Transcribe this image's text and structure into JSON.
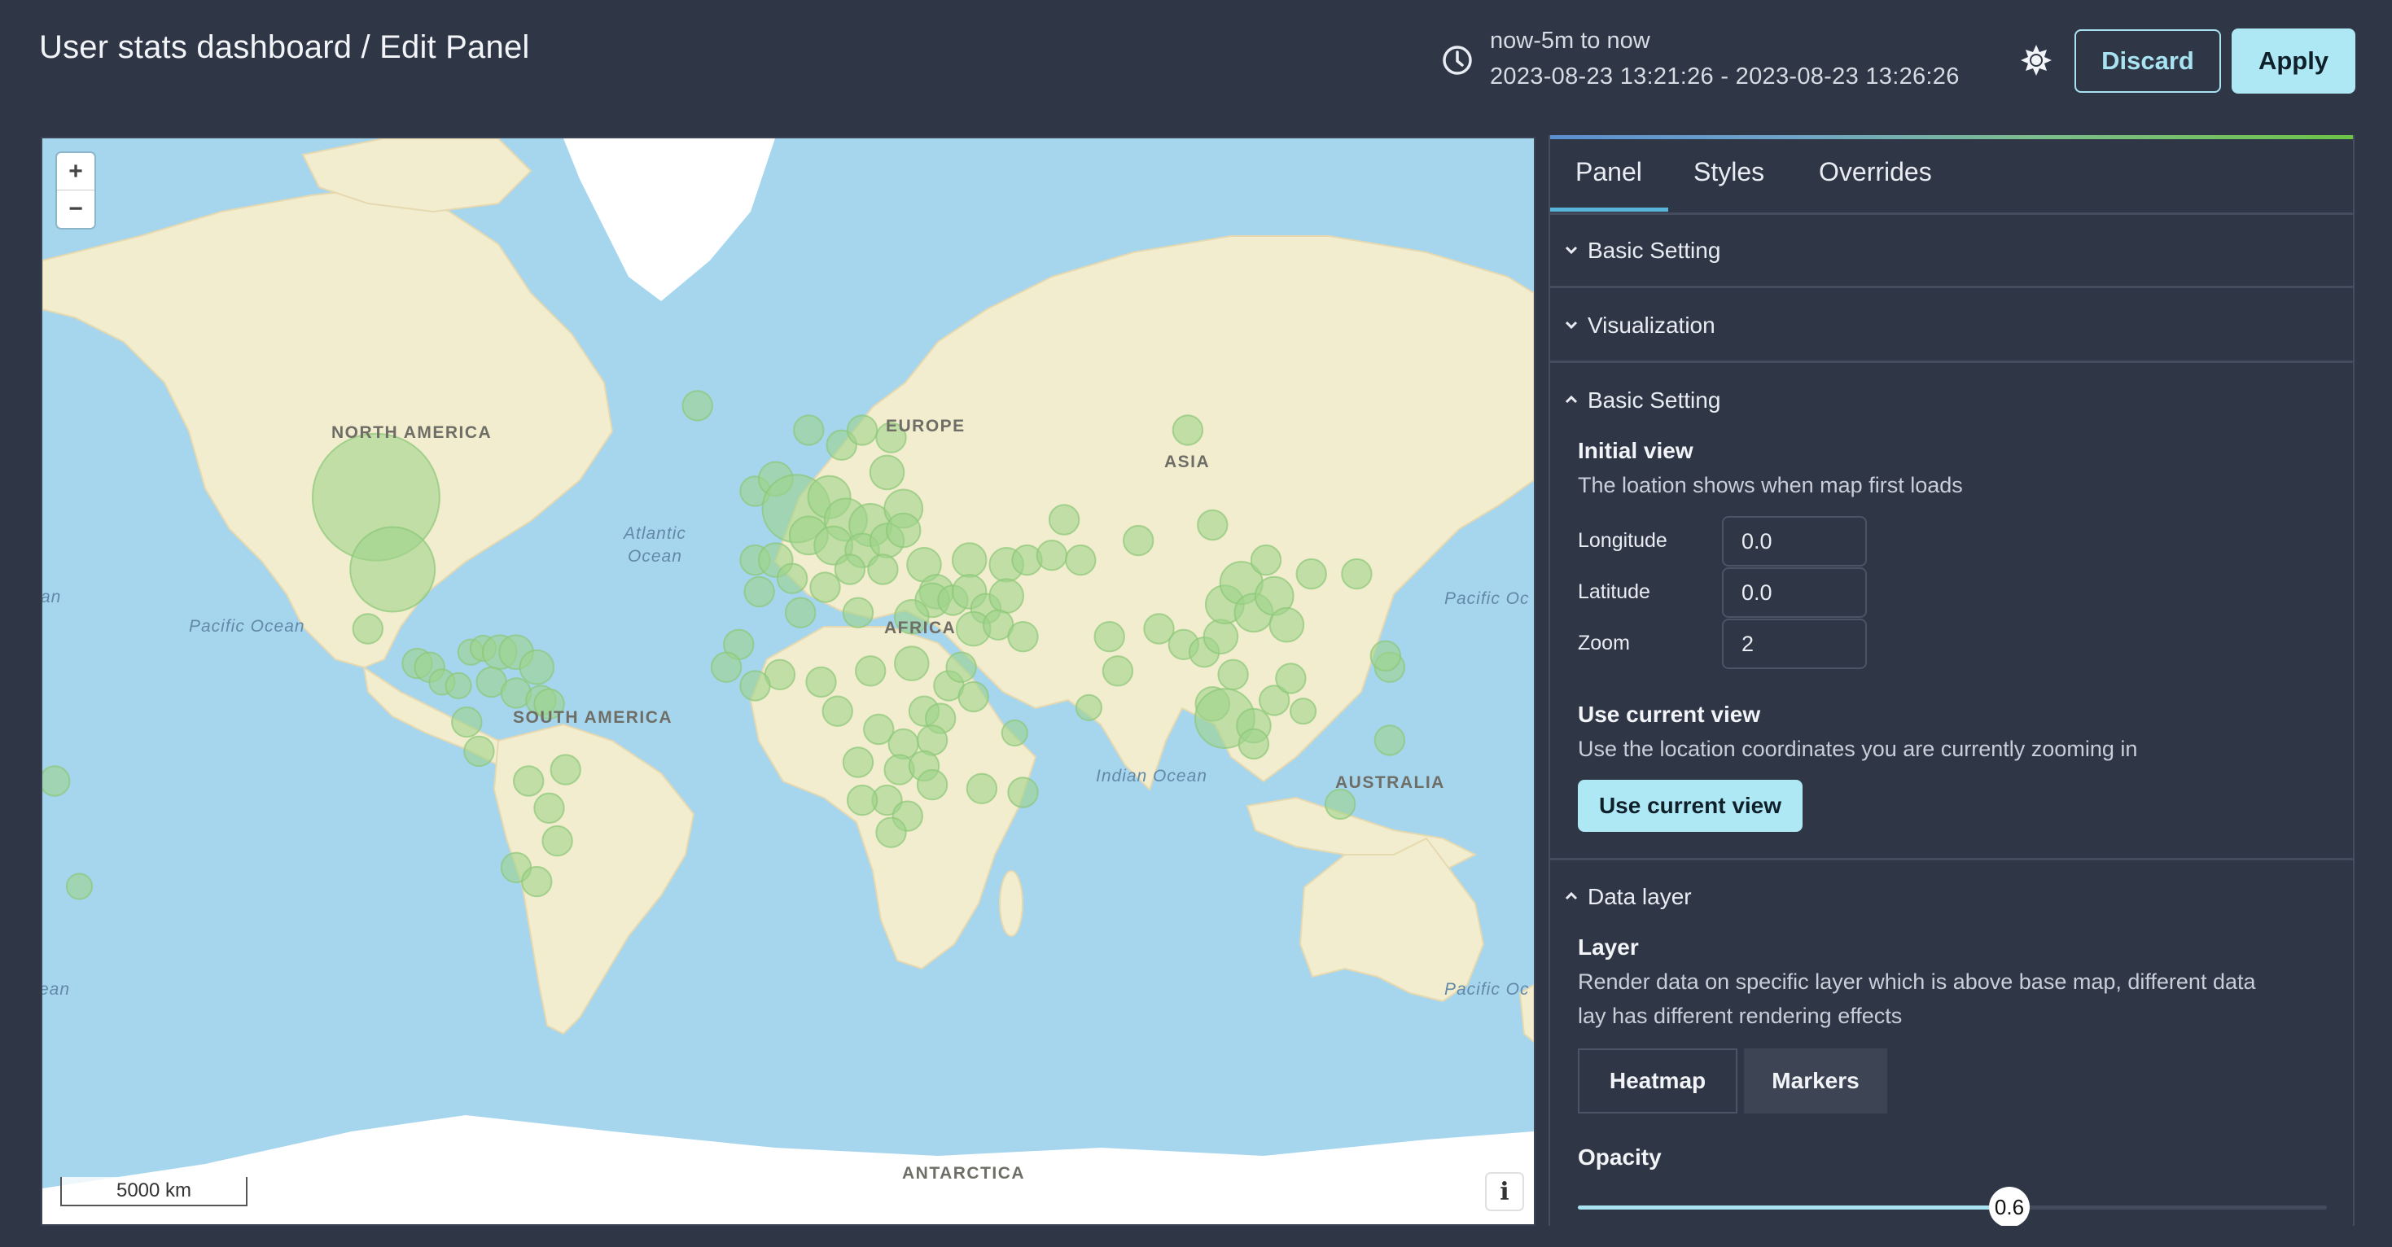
{
  "header": {
    "title": "User stats dashboard / Edit Panel",
    "time_range_label": "now-5m to now",
    "time_range_absolute": "2023-08-23 13:21:26 - 2023-08-23 13:26:26",
    "clock_icon": "clock-icon",
    "theme_icon": "sun-icon",
    "discard_label": "Discard",
    "apply_label": "Apply"
  },
  "map": {
    "zoom_in_label": "+",
    "zoom_out_label": "−",
    "scale_label": "5000 km",
    "info_label": "i",
    "continent_labels": [
      "NORTH AMERICA",
      "SOUTH AMERICA",
      "EUROPE",
      "AFRICA",
      "ASIA",
      "AUSTRALIA",
      "ANTARCTICA"
    ],
    "ocean_labels": {
      "atlantic_line1": "Atlantic",
      "atlantic_line2": "Ocean",
      "pacific_west": "Pacific Ocean",
      "pacific_east_north": "Pacific Oc",
      "pacific_east_south": "Pacific Oc",
      "indian": "Indian Ocean",
      "left_edge_north": "an",
      "left_edge_south": "ean"
    },
    "marker_color": "#9fd48a",
    "marker_opacity": 0.6,
    "markers": [
      {
        "lon": -100,
        "lat": 52,
        "size": 3.0
      },
      {
        "lon": -96,
        "lat": 38,
        "size": 2.0
      },
      {
        "lon": -102,
        "lat": 24,
        "size": 0.7
      },
      {
        "lon": -90,
        "lat": 15,
        "size": 0.7
      },
      {
        "lon": -87,
        "lat": 14,
        "size": 0.7
      },
      {
        "lon": -84,
        "lat": 10,
        "size": 0.6
      },
      {
        "lon": -80,
        "lat": 9,
        "size": 0.6
      },
      {
        "lon": -77,
        "lat": 18,
        "size": 0.6
      },
      {
        "lon": -74,
        "lat": 19,
        "size": 0.6
      },
      {
        "lon": -70,
        "lat": 18,
        "size": 0.8
      },
      {
        "lon": -66,
        "lat": 18,
        "size": 0.8
      },
      {
        "lon": -61,
        "lat": 14,
        "size": 0.8
      },
      {
        "lon": -72,
        "lat": 10,
        "size": 0.7
      },
      {
        "lon": -66,
        "lat": 7,
        "size": 0.7
      },
      {
        "lon": -60,
        "lat": 5,
        "size": 0.7
      },
      {
        "lon": -58,
        "lat": 4,
        "size": 0.7
      },
      {
        "lon": -78,
        "lat": -1,
        "size": 0.7
      },
      {
        "lon": -75,
        "lat": -9,
        "size": 0.7
      },
      {
        "lon": -63,
        "lat": -17,
        "size": 0.7
      },
      {
        "lon": -54,
        "lat": -14,
        "size": 0.7
      },
      {
        "lon": -58,
        "lat": -24,
        "size": 0.7
      },
      {
        "lon": -56,
        "lat": -32,
        "size": 0.7
      },
      {
        "lon": -66,
        "lat": -38,
        "size": 0.7
      },
      {
        "lon": -61,
        "lat": -41,
        "size": 0.7
      },
      {
        "lon": -178,
        "lat": -17,
        "size": 0.7
      },
      {
        "lon": -172,
        "lat": -42,
        "size": 0.6
      },
      {
        "lon": -22,
        "lat": 65,
        "size": 0.7
      },
      {
        "lon": -8,
        "lat": 53,
        "size": 0.7
      },
      {
        "lon": -3,
        "lat": 55,
        "size": 0.8
      },
      {
        "lon": 2,
        "lat": 50,
        "size": 1.6
      },
      {
        "lon": 5,
        "lat": 62,
        "size": 0.7
      },
      {
        "lon": 13,
        "lat": 60,
        "size": 0.7
      },
      {
        "lon": 18,
        "lat": 62,
        "size": 0.7
      },
      {
        "lon": 25,
        "lat": 61,
        "size": 0.7
      },
      {
        "lon": 24,
        "lat": 56,
        "size": 0.8
      },
      {
        "lon": 10,
        "lat": 52,
        "size": 1.0
      },
      {
        "lon": 14,
        "lat": 48,
        "size": 1.0
      },
      {
        "lon": 20,
        "lat": 47,
        "size": 1.0
      },
      {
        "lon": 28,
        "lat": 50,
        "size": 0.9
      },
      {
        "lon": 5,
        "lat": 45,
        "size": 0.9
      },
      {
        "lon": 11,
        "lat": 43,
        "size": 0.9
      },
      {
        "lon": 18,
        "lat": 42,
        "size": 0.8
      },
      {
        "lon": 24,
        "lat": 44,
        "size": 0.8
      },
      {
        "lon": 28,
        "lat": 46,
        "size": 0.8
      },
      {
        "lon": -8,
        "lat": 40,
        "size": 0.7
      },
      {
        "lon": -3,
        "lat": 40,
        "size": 0.8
      },
      {
        "lon": 1,
        "lat": 36,
        "size": 0.7
      },
      {
        "lon": -7,
        "lat": 33,
        "size": 0.7
      },
      {
        "lon": 9,
        "lat": 34,
        "size": 0.7
      },
      {
        "lon": 15,
        "lat": 38,
        "size": 0.7
      },
      {
        "lon": 23,
        "lat": 38,
        "size": 0.7
      },
      {
        "lon": 33,
        "lat": 39,
        "size": 0.8
      },
      {
        "lon": 44,
        "lat": 40,
        "size": 0.8
      },
      {
        "lon": 53,
        "lat": 39,
        "size": 0.8
      },
      {
        "lon": 67,
        "lat": 48,
        "size": 0.7
      },
      {
        "lon": 85,
        "lat": 44,
        "size": 0.7
      },
      {
        "lon": 103,
        "lat": 47,
        "size": 0.7
      },
      {
        "lon": 97,
        "lat": 62,
        "size": 0.7
      },
      {
        "lon": 58,
        "lat": 40,
        "size": 0.7
      },
      {
        "lon": 64,
        "lat": 41,
        "size": 0.7
      },
      {
        "lon": 71,
        "lat": 40,
        "size": 0.7
      },
      {
        "lon": 36,
        "lat": 33,
        "size": 0.8
      },
      {
        "lon": 35,
        "lat": 31,
        "size": 0.8
      },
      {
        "lon": 40,
        "lat": 31,
        "size": 0.7
      },
      {
        "lon": 44,
        "lat": 33,
        "size": 0.8
      },
      {
        "lon": 48,
        "lat": 29,
        "size": 0.7
      },
      {
        "lon": 53,
        "lat": 32,
        "size": 0.8
      },
      {
        "lon": 45,
        "lat": 24,
        "size": 0.8
      },
      {
        "lon": 51,
        "lat": 25,
        "size": 0.7
      },
      {
        "lon": 57,
        "lat": 22,
        "size": 0.7
      },
      {
        "lon": 30,
        "lat": 27,
        "size": 0.8
      },
      {
        "lon": 17,
        "lat": 28,
        "size": 0.7
      },
      {
        "lon": 3,
        "lat": 28,
        "size": 0.7
      },
      {
        "lon": -12,
        "lat": 20,
        "size": 0.7
      },
      {
        "lon": -15,
        "lat": 14,
        "size": 0.7
      },
      {
        "lon": -2,
        "lat": 12,
        "size": 0.7
      },
      {
        "lon": -8,
        "lat": 9,
        "size": 0.7
      },
      {
        "lon": 8,
        "lat": 10,
        "size": 0.7
      },
      {
        "lon": 20,
        "lat": 13,
        "size": 0.7
      },
      {
        "lon": 30,
        "lat": 15,
        "size": 0.8
      },
      {
        "lon": 39,
        "lat": 9,
        "size": 0.7
      },
      {
        "lon": 45,
        "lat": 6,
        "size": 0.7
      },
      {
        "lon": 42,
        "lat": 14,
        "size": 0.7
      },
      {
        "lon": 33,
        "lat": 2,
        "size": 0.7
      },
      {
        "lon": 37,
        "lat": 0,
        "size": 0.7
      },
      {
        "lon": 12,
        "lat": 2,
        "size": 0.7
      },
      {
        "lon": 22,
        "lat": -3,
        "size": 0.7
      },
      {
        "lon": 28,
        "lat": -7,
        "size": 0.7
      },
      {
        "lon": 35,
        "lat": -6,
        "size": 0.7
      },
      {
        "lon": 17,
        "lat": -12,
        "size": 0.7
      },
      {
        "lon": 27,
        "lat": -14,
        "size": 0.7
      },
      {
        "lon": 33,
        "lat": -13,
        "size": 0.7
      },
      {
        "lon": 35,
        "lat": -18,
        "size": 0.7
      },
      {
        "lon": 24,
        "lat": -22,
        "size": 0.7
      },
      {
        "lon": 18,
        "lat": -22,
        "size": 0.7
      },
      {
        "lon": 29,
        "lat": -26,
        "size": 0.7
      },
      {
        "lon": 25,
        "lat": -30,
        "size": 0.7
      },
      {
        "lon": 47,
        "lat": -19,
        "size": 0.7
      },
      {
        "lon": 57,
        "lat": -20,
        "size": 0.7
      },
      {
        "lon": 55,
        "lat": -4,
        "size": 0.6
      },
      {
        "lon": 73,
        "lat": 3,
        "size": 0.6
      },
      {
        "lon": 78,
        "lat": 22,
        "size": 0.7
      },
      {
        "lon": 80,
        "lat": 13,
        "size": 0.7
      },
      {
        "lon": 90,
        "lat": 24,
        "size": 0.7
      },
      {
        "lon": 96,
        "lat": 20,
        "size": 0.7
      },
      {
        "lon": 101,
        "lat": 18,
        "size": 0.7
      },
      {
        "lon": 105,
        "lat": 22,
        "size": 0.8
      },
      {
        "lon": 106,
        "lat": 30,
        "size": 0.9
      },
      {
        "lon": 110,
        "lat": 35,
        "size": 1.0
      },
      {
        "lon": 113,
        "lat": 28,
        "size": 0.9
      },
      {
        "lon": 118,
        "lat": 32,
        "size": 0.9
      },
      {
        "lon": 121,
        "lat": 25,
        "size": 0.8
      },
      {
        "lon": 116,
        "lat": 40,
        "size": 0.7
      },
      {
        "lon": 127,
        "lat": 37,
        "size": 0.7
      },
      {
        "lon": 138,
        "lat": 37,
        "size": 0.7
      },
      {
        "lon": 108,
        "lat": 12,
        "size": 0.7
      },
      {
        "lon": 103,
        "lat": 4,
        "size": 0.8
      },
      {
        "lon": 106,
        "lat": 0,
        "size": 1.4
      },
      {
        "lon": 113,
        "lat": -2,
        "size": 0.8
      },
      {
        "lon": 118,
        "lat": 5,
        "size": 0.7
      },
      {
        "lon": 122,
        "lat": 11,
        "size": 0.7
      },
      {
        "lon": 113,
        "lat": -7,
        "size": 0.7
      },
      {
        "lon": 125,
        "lat": 2,
        "size": 0.6
      },
      {
        "lon": 146,
        "lat": 14,
        "size": 0.7
      },
      {
        "lon": 146,
        "lat": -6,
        "size": 0.7
      },
      {
        "lon": 134,
        "lat": -23,
        "size": 0.7
      },
      {
        "lon": 145,
        "lat": 17,
        "size": 0.7
      }
    ]
  },
  "panel": {
    "tabs": [
      {
        "label": "Panel",
        "active": true
      },
      {
        "label": "Styles",
        "active": false
      },
      {
        "label": "Overrides",
        "active": false
      }
    ],
    "sections": [
      {
        "label": "Basic Setting",
        "expanded": false
      },
      {
        "label": "Visualization",
        "expanded": false
      },
      {
        "label": "Basic Setting",
        "expanded": true
      },
      {
        "label": "Data layer",
        "expanded": true
      }
    ],
    "initial_view": {
      "title": "Initial view",
      "description": "The loation shows when map first loads",
      "fields": [
        {
          "label": "Longitude",
          "value": "0.0"
        },
        {
          "label": "Latitude",
          "value": "0.0"
        },
        {
          "label": "Zoom",
          "value": "2"
        }
      ]
    },
    "use_current_view": {
      "title": "Use current view",
      "description": "Use the location coordinates you are currently zooming in",
      "button_label": "Use current view"
    },
    "layer": {
      "title": "Layer",
      "description_line1": "Render data on specific layer which is above base map, different data",
      "description_line2": "lay has different rendering effects",
      "options": [
        "Heatmap",
        "Markers"
      ],
      "selected": "Markers"
    },
    "opacity": {
      "title": "Opacity",
      "value": 0.6,
      "value_label": "0.6",
      "min": 0,
      "max": 1
    }
  },
  "colors": {
    "background": "#2f3646",
    "accent": "#ade8f4",
    "tab_indicator": "#56b5d8",
    "ocean": "#a6d5ee",
    "land": "#f3edcf"
  }
}
